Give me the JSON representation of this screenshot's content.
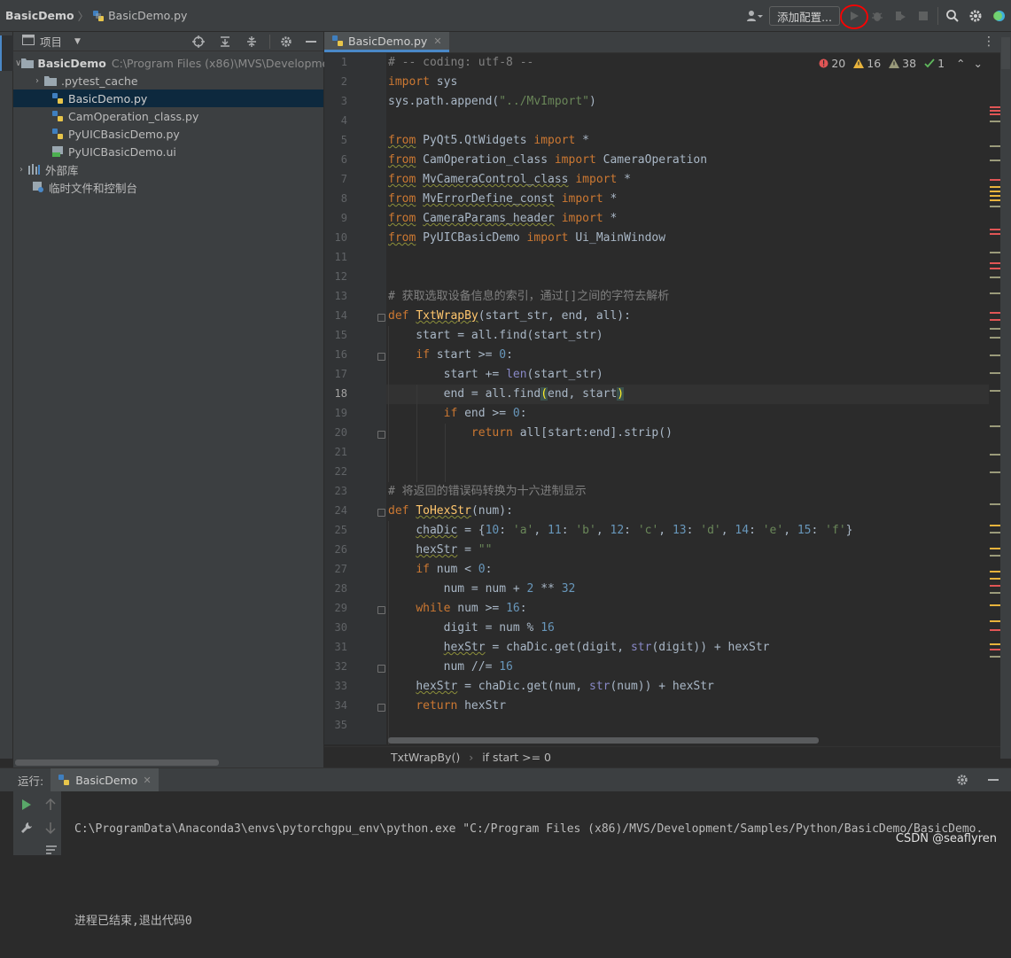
{
  "titlebar": {
    "project": "BasicDemo",
    "file": "BasicDemo.py",
    "add_config": "添加配置..."
  },
  "project_panel": {
    "title": "项目",
    "tree": [
      {
        "label": "BasicDemo",
        "detail": "C:\\Program Files (x86)\\MVS\\Developmer",
        "kind": "folder",
        "expanded": true
      },
      {
        "label": ".pytest_cache",
        "kind": "folder",
        "expanded": false
      },
      {
        "label": "BasicDemo.py",
        "kind": "python",
        "selected": true
      },
      {
        "label": "CamOperation_class.py",
        "kind": "python"
      },
      {
        "label": "PyUICBasicDemo.py",
        "kind": "python"
      },
      {
        "label": "PyUICBasicDemo.ui",
        "kind": "ui"
      },
      {
        "label": "外部库",
        "kind": "library",
        "expanded": false
      },
      {
        "label": "临时文件和控制台",
        "kind": "scratch"
      }
    ]
  },
  "editor": {
    "tab": "BasicDemo.py",
    "inspections": {
      "errors": "20",
      "warnings": "16",
      "weak": "38",
      "ok": "1"
    },
    "lines": [
      "1",
      "2",
      "3",
      "4",
      "5",
      "6",
      "7",
      "8",
      "9",
      "10",
      "11",
      "12",
      "13",
      "14",
      "15",
      "16",
      "17",
      "18",
      "19",
      "20",
      "21",
      "22",
      "23",
      "24",
      "25",
      "26",
      "27",
      "28",
      "29",
      "30",
      "31",
      "32",
      "33",
      "34",
      "35"
    ],
    "current_line": "18",
    "breadcrumbs": [
      "TxtWrapBy()",
      "if start >= 0"
    ]
  },
  "run_panel": {
    "label": "运行:",
    "tab": "BasicDemo",
    "command": "C:\\ProgramData\\Anaconda3\\envs\\pytorchgpu_env\\python.exe \"C:/Program Files (x86)/MVS/Development/Samples/Python/BasicDemo/BasicDemo.",
    "exit_message": "进程已结束,退出代码0"
  },
  "watermark": "CSDN @seaflyren",
  "colors": {
    "accent": "#4a88c7",
    "keyword": "#cc7832",
    "string": "#6a8759",
    "number": "#6897bb",
    "comment": "#808080",
    "function": "#ffc66d",
    "error": "#e05555",
    "warning": "#e8b33c",
    "highlight_circle": "#ff0000"
  }
}
